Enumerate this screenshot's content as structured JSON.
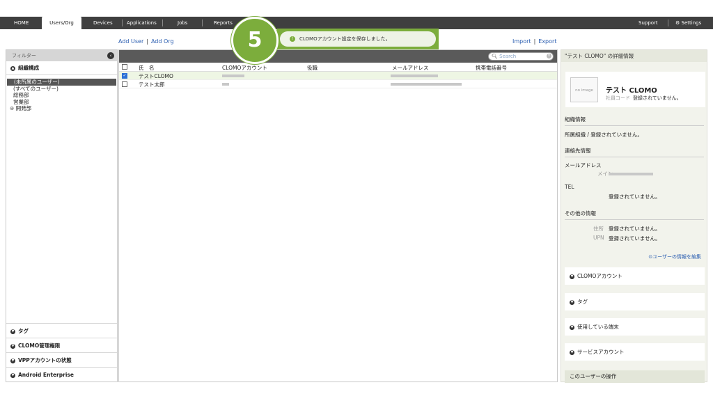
{
  "nav": {
    "home": "HOME",
    "users": "Users/Org",
    "devices": "Devices",
    "applications": "Applications",
    "jobs": "Jobs",
    "reports": "Reports",
    "support": "Support",
    "settings": "Settings"
  },
  "links": {
    "add_user": "Add User",
    "add_org": "Add Org",
    "import": "Import",
    "export": "Export"
  },
  "toast": {
    "step": "5",
    "message": "CLOMOアカウント設定を保存しました。"
  },
  "filter": {
    "title": "フィルター",
    "org_section": "組織構成",
    "orgs": [
      "(未所属のユーザー)",
      "(すべてのユーザー)",
      "総務部",
      "営業部",
      "開発部"
    ],
    "bottom_sections": [
      "タグ",
      "CLOMO管理権限",
      "VPPアカウントの状態",
      "Android Enterprise"
    ]
  },
  "table": {
    "search_placeholder": "Search",
    "columns": [
      "氏　名",
      "CLOMOアカウント",
      "役職",
      "メールアドレス",
      "携帯電話番号"
    ],
    "rows": [
      {
        "name": "テストCLOMO",
        "checked": true
      },
      {
        "name": "テスト太郎",
        "checked": false
      }
    ]
  },
  "detail": {
    "header": "\"テスト CLOMO\" の詳細情報",
    "no_image": "no image",
    "name": "テスト CLOMO",
    "code_label": "社員コード",
    "code_value": "登録されていません。",
    "org_section": "組織情報",
    "org_text": "所属組織 / 登録されていません。",
    "contact_section": "連絡先情報",
    "email_label": "メールアドレス",
    "email_sub": "メイン",
    "tel_label": "TEL",
    "tel_value": "登録されていません。",
    "other_section": "その他の情報",
    "address_label": "住所",
    "address_value": "登録されていません。",
    "upn_label": "UPN",
    "upn_value": "登録されていません。",
    "edit_link": "ユーザーの情報を編集",
    "accordions": [
      "CLOMOアカウント",
      "タグ",
      "使用している端末",
      "サービスアカウント"
    ],
    "operations": "このユーザーの操作"
  }
}
